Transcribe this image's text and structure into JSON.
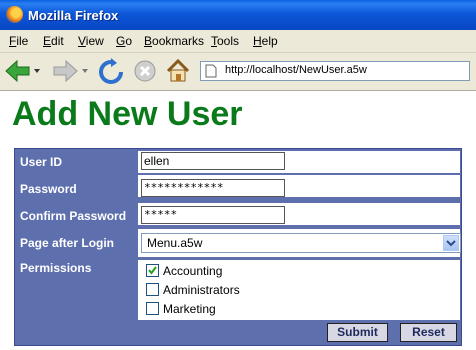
{
  "window": {
    "title": "Mozilla Firefox"
  },
  "menu": [
    "File",
    "Edit",
    "View",
    "Go",
    "Bookmarks",
    "Tools",
    "Help"
  ],
  "toolbar": {
    "url": "http://localhost/NewUser.a5w"
  },
  "page": {
    "heading": "Add New User",
    "form": {
      "user_id_label": "User ID",
      "user_id_value": "ellen",
      "password_label": "Password",
      "password_value": "************",
      "confirm_label": "Confirm Password",
      "confirm_value": "*****",
      "page_after_login_label": "Page after Login",
      "page_after_login_value": "Menu.a5w",
      "permissions_label": "Permissions",
      "permissions": [
        {
          "label": "Accounting",
          "checked": true
        },
        {
          "label": "Administrators",
          "checked": false
        },
        {
          "label": "Marketing",
          "checked": false
        }
      ],
      "submit_label": "Submit",
      "reset_label": "Reset"
    }
  },
  "colors": {
    "heading": "#0b7a1b",
    "form_background": "#5e6fae",
    "titlebar": "#0846c4"
  }
}
